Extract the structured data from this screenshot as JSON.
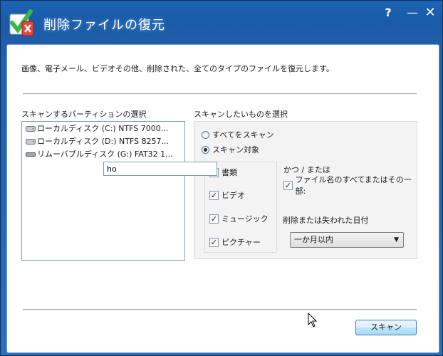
{
  "window": {
    "title": "削除ファイルの復元",
    "controls": {
      "help": "?",
      "minimize": "—",
      "close": "✕"
    }
  },
  "description": "画像、電子メール、ビデオその他、削除された、全てのタイプのファイルを復元します。",
  "partition": {
    "label": "スキャンするパーティションの選択",
    "items": [
      {
        "text": "ローカルディスク (C:)  NTFS  7000..."
      },
      {
        "text": "ローカルディスク (D:)  NTFS  8257..."
      },
      {
        "text": "リムーバブルディスク (G:)  FAT32  1..."
      }
    ]
  },
  "scan": {
    "label": "スキャンしたいものを選択",
    "radios": [
      {
        "label": "すべてをスキャン",
        "checked": false
      },
      {
        "label": "スキャン対象",
        "checked": true
      }
    ],
    "types": [
      {
        "label": "書類",
        "checked": true
      },
      {
        "label": "ビデオ",
        "checked": true
      },
      {
        "label": "ミュージック",
        "checked": true
      },
      {
        "label": "ピクチャー",
        "checked": true
      }
    ],
    "and_or": "かつ / または",
    "filename_check_label": "ファイル名のすべてまたはその一部:",
    "filename_check_checked": true,
    "filename_value": "ho",
    "date_label": "削除または失われた日付",
    "date_select_value": "一か月以内"
  },
  "buttons": {
    "scan": "スキャン"
  }
}
